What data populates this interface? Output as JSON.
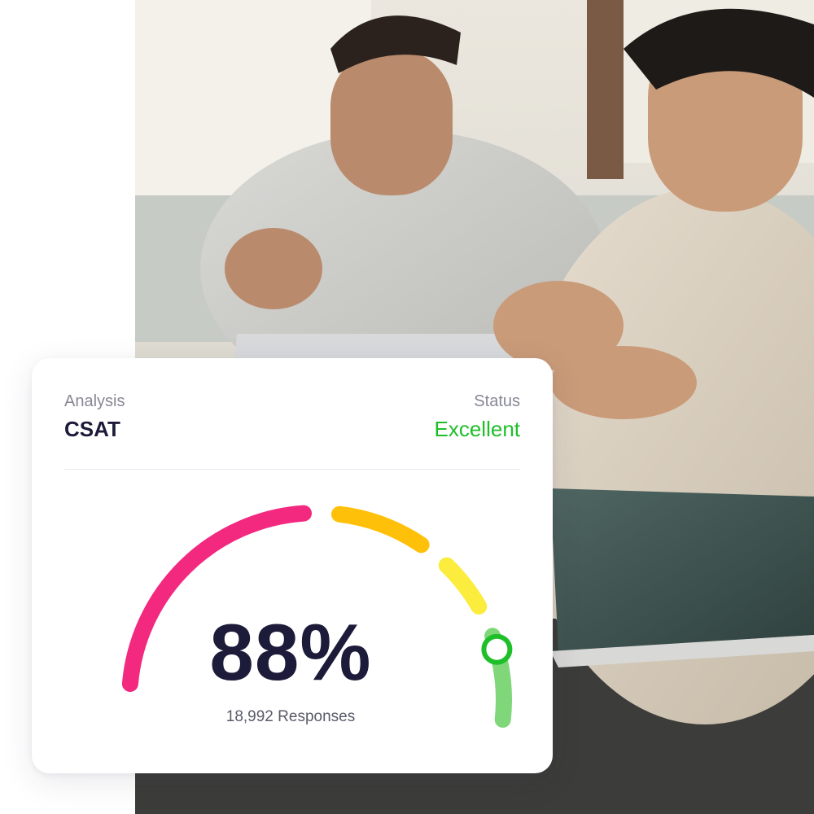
{
  "card": {
    "left_label": "Analysis",
    "left_value": "CSAT",
    "right_label": "Status",
    "right_value": "Excellent",
    "score": "88%",
    "responses_count": "18,992",
    "responses_label": "Responses"
  },
  "gauge": {
    "level": 0.88,
    "colors": {
      "pink": "#f2297f",
      "orange": "#ffc009",
      "yellow": "#fbec3d",
      "green": "#7fd77a",
      "marker": "#1fbf2a"
    }
  },
  "colors": {
    "text_primary": "#1d1b3a",
    "text_muted": "#878796",
    "status_green": "#1fbf2a"
  }
}
